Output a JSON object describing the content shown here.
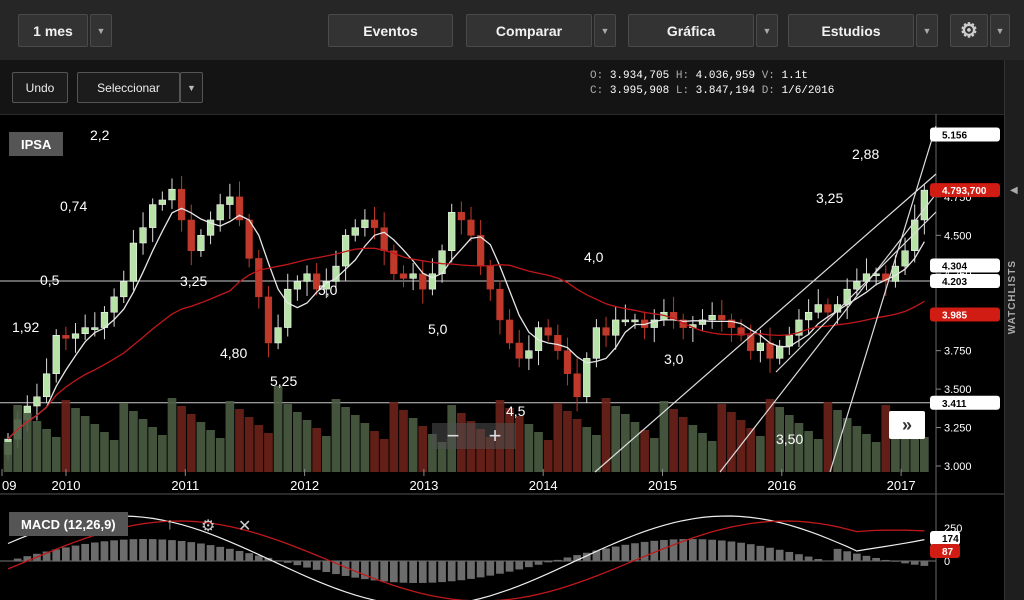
{
  "toolbar": {
    "period": "1 mes",
    "events": "Eventos",
    "compare": "Comparar",
    "chart": "Gráfica",
    "studies": "Estudios"
  },
  "row2": {
    "undo": "Undo",
    "select": "Seleccionar"
  },
  "ohlc": {
    "o_label": "O:",
    "o": "3.934,705",
    "h_label": "H:",
    "h": "4.036,959",
    "v_label": "V:",
    "v": "1.1t",
    "c_label": "C:",
    "c": "3.995,908",
    "l_label": "L:",
    "l": "3.847,194",
    "d_label": "D:",
    "d": "1/6/2016"
  },
  "side_tab": "WATCHLISTS",
  "chart_data": [
    {
      "type": "candlestick",
      "title": "IPSA",
      "x_ticks": [
        "09",
        "2010",
        "2011",
        "2012",
        "2013",
        "2014",
        "2015",
        "2016",
        "2017"
      ],
      "y_ticks": [
        "3.000",
        "3.250",
        "3.500",
        "3.750",
        "4.000",
        "4.250",
        "4.500",
        "4.750"
      ],
      "ylim": [
        3000,
        5250
      ],
      "y_tags": [
        {
          "label": "5.156",
          "value": 5156,
          "style": "white"
        },
        {
          "label": "4.793,700",
          "value": 4793.7,
          "style": "red"
        },
        {
          "label": "4.304",
          "value": 4304,
          "style": "white"
        },
        {
          "label": "4.203",
          "value": 4203,
          "style": "white"
        },
        {
          "label": "3.985",
          "value": 3985,
          "style": "red"
        },
        {
          "label": "3.411",
          "value": 3411,
          "style": "white"
        }
      ],
      "horizontal_lines": [
        4203,
        3411
      ],
      "annotations": [
        "2,2",
        "0,74",
        "0,5",
        "1,92",
        "3,25",
        "4,80",
        "5,25",
        "5,0",
        "5,0",
        "4,0",
        "4,5",
        "3,0",
        "3,50",
        "3,25",
        "2,88"
      ],
      "close_monthly": [
        3175,
        3300,
        3390,
        3450,
        3600,
        3850,
        3830,
        3860,
        3900,
        3900,
        4000,
        4100,
        4200,
        4450,
        4550,
        4700,
        4730,
        4800,
        4600,
        4400,
        4500,
        4600,
        4700,
        4750,
        4600,
        4350,
        4100,
        3800,
        3900,
        4150,
        4200,
        4250,
        4150,
        4200,
        4300,
        4500,
        4550,
        4600,
        4550,
        4400,
        4250,
        4220,
        4250,
        4150,
        4250,
        4400,
        4650,
        4600,
        4500,
        4300,
        4150,
        3950,
        3800,
        3700,
        3750,
        3900,
        3850,
        3750,
        3600,
        3450,
        3700,
        3900,
        3850,
        3950,
        3950,
        3950,
        3900,
        3950,
        4000,
        3950,
        3900,
        3920,
        3950,
        3980,
        3950,
        3900,
        3850,
        3750,
        3800,
        3700,
        3780,
        3850,
        3950,
        4000,
        4050,
        4000,
        4050,
        4150,
        4200,
        4250,
        4250,
        4200,
        4300,
        4400,
        4600,
        4794
      ],
      "volume_scale": "relative"
    },
    {
      "type": "line",
      "title": "MACD (12,26,9)",
      "y_ticks": [
        "250",
        "0"
      ],
      "y_tags": [
        {
          "label": "174",
          "value": 174,
          "style": "white"
        },
        {
          "label": "87",
          "value": 87,
          "style": "red"
        }
      ]
    }
  ]
}
